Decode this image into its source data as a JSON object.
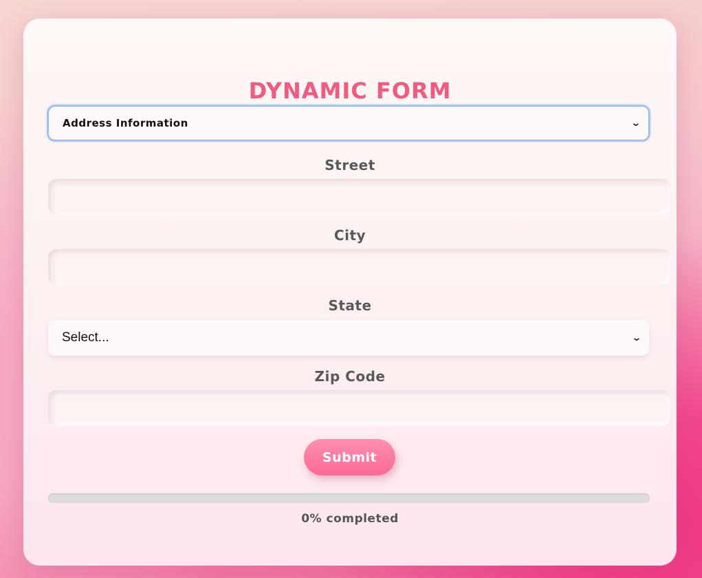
{
  "form": {
    "title": "DYNAMIC FORM",
    "section_select": {
      "selected": "Address Information",
      "icon": "chevron-down-icon"
    },
    "fields": {
      "street": {
        "label": "Street",
        "value": ""
      },
      "city": {
        "label": "City",
        "value": ""
      },
      "state": {
        "label": "State",
        "selected": "Select..."
      },
      "zip": {
        "label": "Zip Code",
        "value": ""
      }
    },
    "submit_label": "Submit",
    "progress": {
      "percent": 0,
      "text": "0% completed"
    }
  },
  "colors": {
    "accent": "#f35a7e",
    "button": "#fb6a94",
    "label": "#595959",
    "progress_track": "#dcdcdc"
  }
}
